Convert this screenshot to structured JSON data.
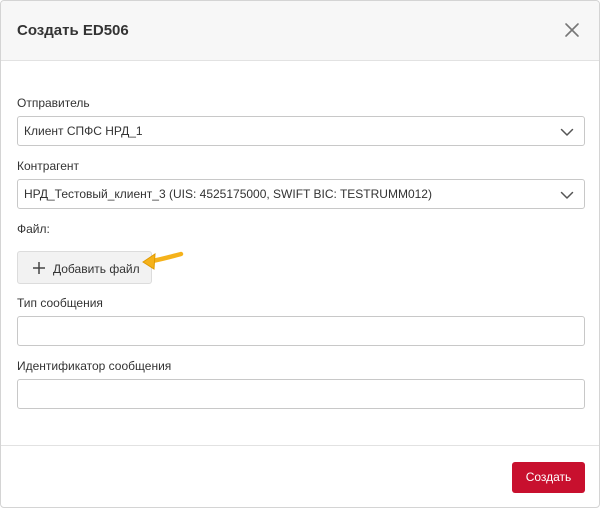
{
  "dialog": {
    "title": "Создать ED506"
  },
  "form": {
    "sender": {
      "label": "Отправитель",
      "value": "Клиент СПФС НРД_1"
    },
    "counterparty": {
      "label": "Контрагент",
      "value": "НРД_Тестовый_клиент_3 (UIS: 4525175000, SWIFT BIC: TESTRUMM012)"
    },
    "file": {
      "label": "Файл:",
      "add_button_label": "Добавить файл"
    },
    "message_type": {
      "label": "Тип сообщения",
      "value": ""
    },
    "message_id": {
      "label": "Идентификатор сообщения",
      "value": ""
    }
  },
  "footer": {
    "create_label": "Создать"
  },
  "colors": {
    "accent": "#c8102e",
    "pointer_arrow": "#f5b21b"
  },
  "icons": {
    "close": "close-icon",
    "chevron": "chevron-down-icon",
    "plus": "plus-icon",
    "pointer": "pointer-arrow-icon"
  }
}
